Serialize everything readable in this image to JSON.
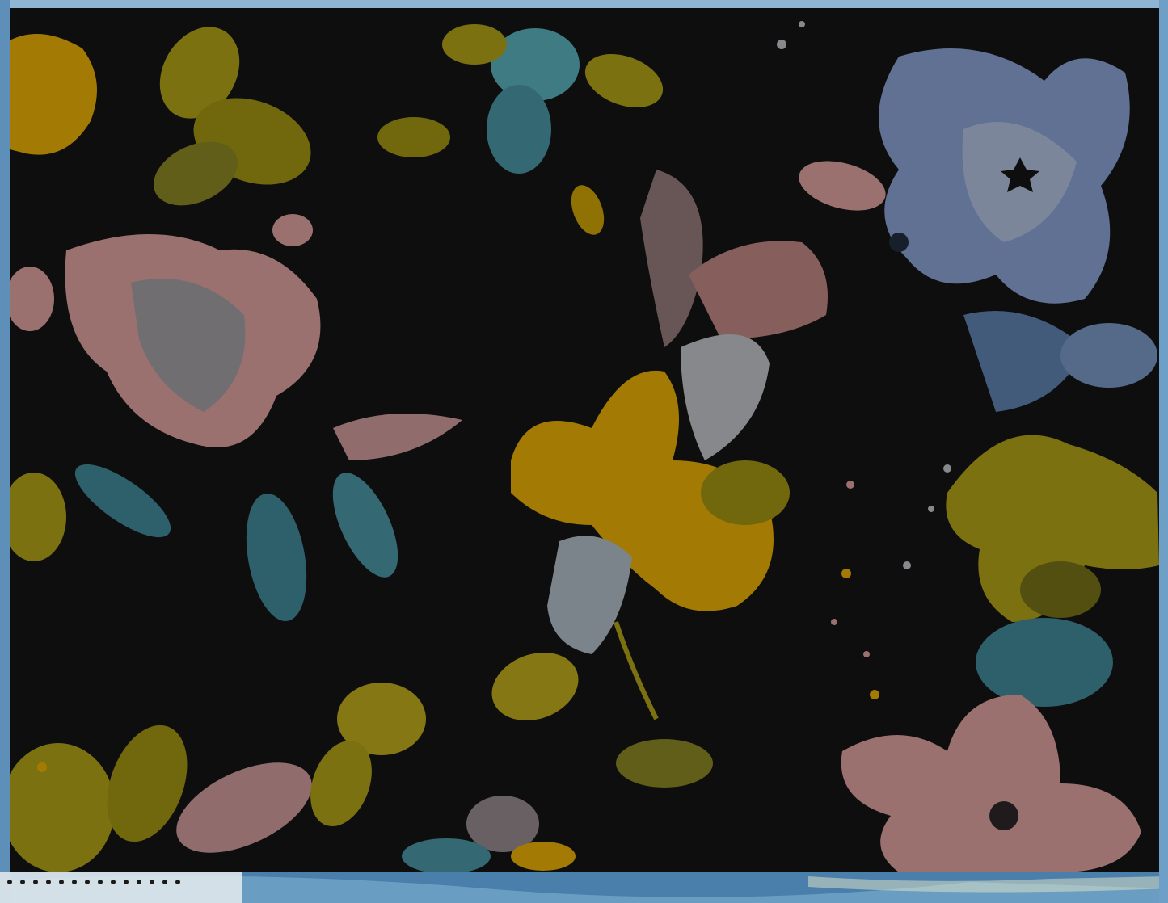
{
  "artwork": {
    "palette": {
      "background": "#0f0f10",
      "frame": "#3a6a93",
      "yellow": "#f5b800",
      "olive": "#b8a814",
      "pink": "#e8a8a6",
      "periwinkle": "#8fa8dc",
      "teal": "#5ab8c4",
      "silver": "#c8ccd2"
    }
  }
}
